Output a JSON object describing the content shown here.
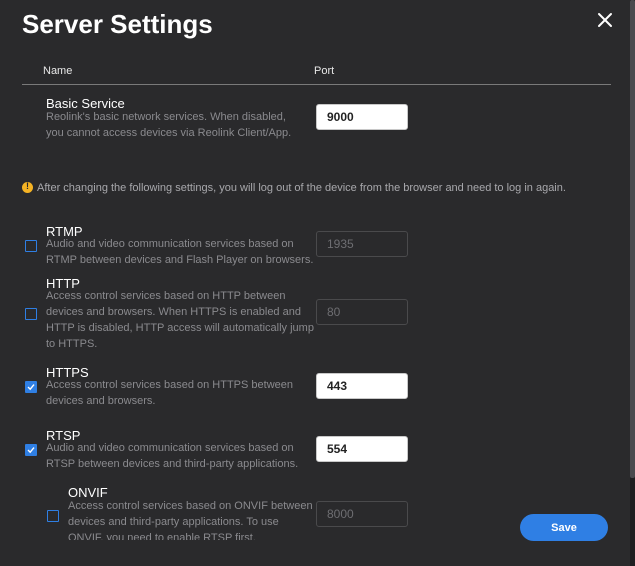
{
  "dialog": {
    "title": "Server Settings",
    "close_icon": "close-icon"
  },
  "table": {
    "col_name": "Name",
    "col_port": "Port"
  },
  "basic_service": {
    "title": "Basic Service",
    "desc_1": "Reolink's basic network services. When disabled,",
    "desc_2": "you cannot access devices via Reolink Client/App.",
    "port": "9000"
  },
  "warning": {
    "icon": "warning-icon",
    "color": "#f5b324",
    "text": "After changing the following settings, you will log out of the device from the browser and need to log in again."
  },
  "services": {
    "rtmp": {
      "title": "RTMP",
      "desc_1": "Audio and video communication services based on",
      "desc_2": "RTMP between devices and Flash Player on browsers.",
      "port": "1935",
      "enabled": false
    },
    "http": {
      "title": "HTTP",
      "desc_1": "Access control services based on HTTP between",
      "desc_2": "devices and browsers. When HTTPS is enabled and",
      "desc_3": "HTTP is disabled, HTTP access will automatically jump",
      "desc_4": "to HTTPS.",
      "port": "80",
      "enabled": false
    },
    "https": {
      "title": "HTTPS",
      "desc_1": "Access control services based on HTTPS between",
      "desc_2": "devices and browsers.",
      "port": "443",
      "enabled": true
    },
    "rtsp": {
      "title": "RTSP",
      "desc_1": "Audio and video communication services based on",
      "desc_2": "RTSP between devices and third-party applications.",
      "port": "554",
      "enabled": true
    },
    "onvif": {
      "title": "ONVIF",
      "desc_1": "Access control services based on ONVIF between",
      "desc_2": "devices and third-party applications. To use",
      "desc_3": "ONVIF, you need to enable RTSP first.",
      "port": "8000",
      "enabled": false
    }
  },
  "footer": {
    "save_label": "Save"
  },
  "colors": {
    "accent": "#2f7fe4",
    "background": "#2a2a2c"
  }
}
